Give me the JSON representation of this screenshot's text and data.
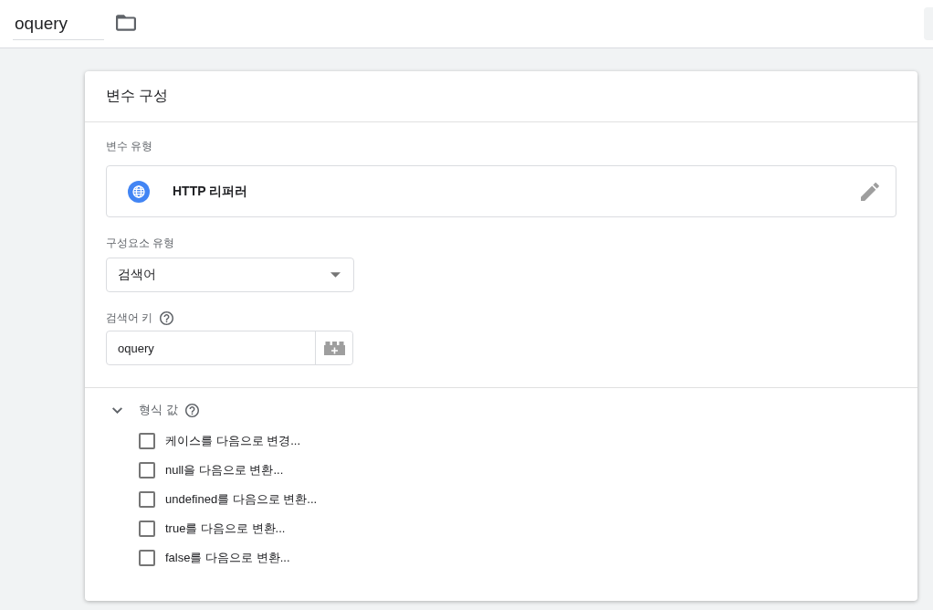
{
  "header": {
    "name_field": {
      "value": "oquery"
    }
  },
  "card": {
    "title": "변수 구성",
    "variable_type": {
      "label": "변수 유형",
      "value": "HTTP 리퍼러"
    },
    "component_type": {
      "label": "구성요소 유형",
      "value": "검색어"
    },
    "query_key": {
      "label": "검색어 키",
      "value": "oquery"
    },
    "format_value": {
      "label": "형식 값",
      "expanded": true,
      "options": [
        {
          "label": "케이스를 다음으로 변경...",
          "checked": false
        },
        {
          "label": "null을 다음으로 변환...",
          "checked": false
        },
        {
          "label": "undefined를 다음으로 변환...",
          "checked": false
        },
        {
          "label": "true를 다음으로 변환...",
          "checked": false
        },
        {
          "label": "false를 다음으로 변환...",
          "checked": false
        }
      ]
    }
  }
}
